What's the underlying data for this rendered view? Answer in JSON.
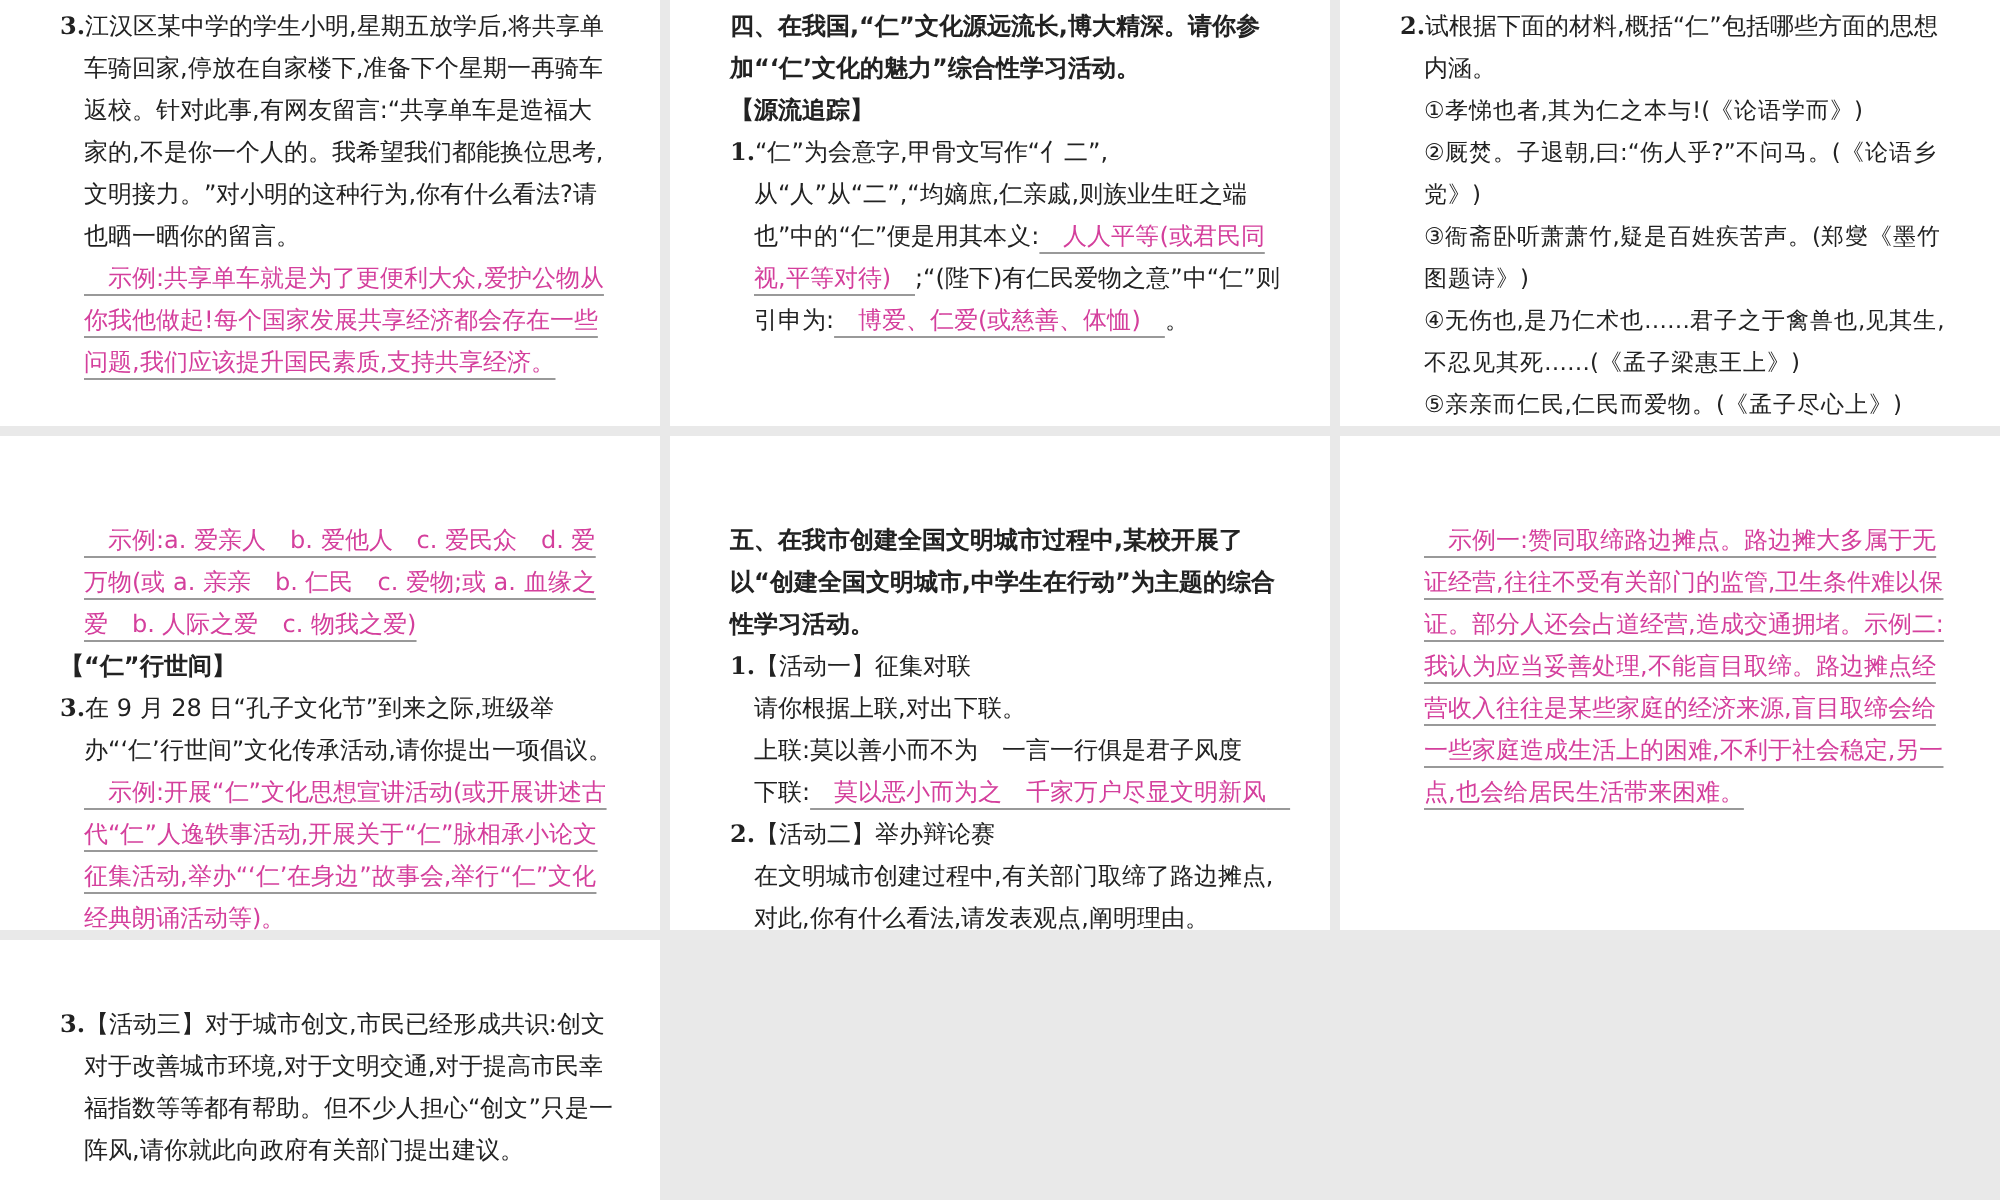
{
  "slides": [
    {
      "paragraphs": [
        {
          "kind": "text",
          "segments": [
            {
              "kind": "num",
              "text": "3."
            },
            {
              "kind": "text",
              "text": "江汉区某中学的学生小明,星期五放学后,将共享单车骑回家,停放在自家楼下,准备下个星期一再骑车返校。针对此事,有网友留言:“共享单车是造福大家的,不是你一个人的。我希望我们都能换位思考,文明接力。”对小明的这种行为,你有什么看法?请也晒一晒你的留言。"
            }
          ]
        },
        {
          "kind": "answer",
          "segments": [
            {
              "kind": "answer",
              "text": "　示例:共享单车就是为了更便利大众,爱护公物从你我他做起!每个国家发展共享经济都会存在一些问题,我们应该提升国民素质,支持共享经济。"
            }
          ]
        }
      ]
    },
    {
      "paragraphs": [
        {
          "kind": "heading",
          "segments": [
            {
              "kind": "text",
              "text": "四、在我国,“仁”文化源远流长,博大精深。请你参加“‘仁’文化的魅力”综合性学习活动。"
            }
          ]
        },
        {
          "kind": "heading",
          "segments": [
            {
              "kind": "text",
              "text": "【源流追踪】"
            }
          ]
        },
        {
          "kind": "text",
          "segments": [
            {
              "kind": "num",
              "text": "1."
            },
            {
              "kind": "text",
              "text": "“仁”为会意字,甲骨文写作“⺅二”,从“人”从“二”,“均嫡庶,仁亲戚,则族业生旺之端也”中的“仁”便是用其本义:"
            },
            {
              "kind": "answer",
              "text": "　人人平等(或君民同视,平等对待)　"
            },
            {
              "kind": "text",
              "text": ";“(陛下)有仁民爱物之意”中“仁”则引申为:"
            },
            {
              "kind": "answer",
              "text": "　博爱、仁爱(或慈善、体恤)　"
            },
            {
              "kind": "text",
              "text": "。"
            }
          ]
        }
      ]
    },
    {
      "paragraphs": [
        {
          "kind": "text",
          "segments": [
            {
              "kind": "num",
              "text": "2."
            },
            {
              "kind": "text",
              "text": "试根据下面的材料,概括“仁”包括哪些方面的思想内涵。"
            }
          ]
        },
        {
          "kind": "quote",
          "segments": [
            {
              "kind": "text",
              "text": "①孝悌也者,其为仁之本与!(《论语学而》)"
            }
          ]
        },
        {
          "kind": "quote",
          "segments": [
            {
              "kind": "text",
              "text": "②厩焚。子退朝,曰:“伤人乎?”不问马。(《论语乡党》)"
            }
          ]
        },
        {
          "kind": "quote",
          "segments": [
            {
              "kind": "text",
              "text": "③衙斋卧听萧萧竹,疑是百姓疾苦声。(郑燮《墨竹图题诗》)"
            }
          ]
        },
        {
          "kind": "quote",
          "segments": [
            {
              "kind": "text",
              "text": "④无伤也,是乃仁术也……君子之于禽兽也,见其生,不忍见其死……(《孟子梁惠王上》)"
            }
          ]
        },
        {
          "kind": "quote",
          "segments": [
            {
              "kind": "text",
              "text": "⑤亲亲而仁民,仁民而爱物。(《孟子尽心上》)"
            }
          ]
        }
      ]
    },
    {
      "paragraphs": [
        {
          "kind": "answer",
          "segments": [
            {
              "kind": "answer",
              "text": "　示例:a. 爱亲人　b. 爱他人　c. 爱民众　d. 爱万物(或 a. 亲亲　b. 仁民　c. 爱物;或 a. 血缘之爱　b. 人际之爱　c. 物我之爱)"
            }
          ]
        },
        {
          "kind": "heading",
          "segments": [
            {
              "kind": "text",
              "text": "【“仁”行世间】"
            }
          ]
        },
        {
          "kind": "text",
          "segments": [
            {
              "kind": "num",
              "text": "3."
            },
            {
              "kind": "text",
              "text": "在 9 月 28 日“孔子文化节”到来之际,班级举办“‘仁’行世间”文化传承活动,请你提出一项倡议。"
            }
          ]
        },
        {
          "kind": "answer",
          "segments": [
            {
              "kind": "answer",
              "text": "　示例:开展“仁”文化思想宣讲活动(或开展讲述古代“仁”人逸轶事活动,开展关于“仁”脉相承小论文征集活动,举办“‘仁’在身边”故事会,举行“仁”文化经典朗诵活动等)。"
            }
          ]
        }
      ]
    },
    {
      "paragraphs": [
        {
          "kind": "heading",
          "segments": [
            {
              "kind": "text",
              "text": "五、在我市创建全国文明城市过程中,某校开展了以“创建全国文明城市,中学生在行动”为主题的综合性学习活动。"
            }
          ]
        },
        {
          "kind": "text",
          "segments": [
            {
              "kind": "num",
              "text": "1."
            },
            {
              "kind": "text",
              "text": "【活动一】征集对联"
            }
          ]
        },
        {
          "kind": "text",
          "segments": [
            {
              "kind": "text",
              "text": "请你根据上联,对出下联。"
            }
          ]
        },
        {
          "kind": "text",
          "segments": [
            {
              "kind": "text",
              "text": "上联:莫以善小而不为　一言一行俱是君子风度"
            }
          ]
        },
        {
          "kind": "text",
          "segments": [
            {
              "kind": "text",
              "text": "下联:"
            },
            {
              "kind": "answer",
              "text": "　莫以恶小而为之　千家万户尽显文明新风　"
            }
          ]
        },
        {
          "kind": "text",
          "segments": [
            {
              "kind": "num",
              "text": "2."
            },
            {
              "kind": "text",
              "text": "【活动二】举办辩论赛"
            }
          ]
        },
        {
          "kind": "text",
          "segments": [
            {
              "kind": "text",
              "text": "在文明城市创建过程中,有关部门取缔了路边摊点,对此,你有什么看法,请发表观点,阐明理由。"
            }
          ]
        }
      ]
    },
    {
      "paragraphs": [
        {
          "kind": "answer",
          "segments": [
            {
              "kind": "answer",
              "text": "　示例一:赞同取缔路边摊点。路边摊大多属于无证经营,往往不受有关部门的监管,卫生条件难以保证。部分人还会占道经营,造成交通拥堵。示例二:我认为应当妥善处理,不能盲目取缔。路边摊点经营收入往往是某些家庭的经济来源,盲目取缔会给一些家庭造成生活上的困难,不利于社会稳定,另一点,也会给居民生活带来困难。"
            }
          ]
        }
      ]
    },
    {
      "paragraphs": [
        {
          "kind": "text",
          "segments": [
            {
              "kind": "num",
              "text": "3."
            },
            {
              "kind": "text",
              "text": "【活动三】对于城市创文,市民已经形成共识:创文对于改善城市环境,对于文明交通,对于提高市民幸福指数等等都有帮助。但不少人担心“创文”只是一阵风,请你就此向政府有关部门提出建议。"
            }
          ]
        }
      ]
    }
  ]
}
